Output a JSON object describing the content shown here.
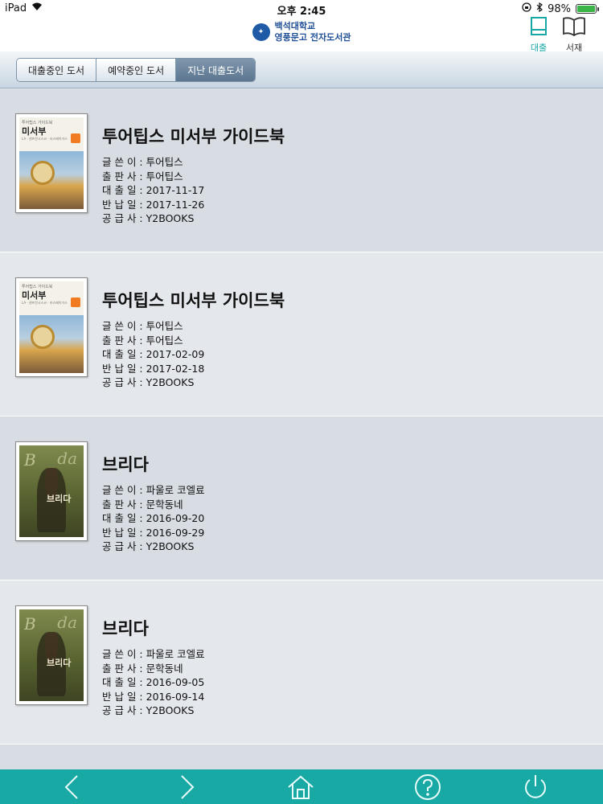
{
  "status_bar": {
    "device": "iPad",
    "time": "오후 2:45",
    "battery_text": "98%",
    "battery_level": 0.98
  },
  "header": {
    "logo_line1": "백석대학교",
    "logo_line2": "영풍문고 전자도서관",
    "loan_label": "대출",
    "shelf_label": "서재"
  },
  "tabs": [
    {
      "label": "대출중인 도서",
      "active": false
    },
    {
      "label": "예약중인 도서",
      "active": false
    },
    {
      "label": "지난 대출도서",
      "active": true
    }
  ],
  "field_labels": {
    "author": "글 쓴 이 :",
    "publisher": "출 판 사 :",
    "loan_date": "대 출 일 :",
    "return_date": "반 납 일 :",
    "supplier": "공 급 사 :"
  },
  "books": [
    {
      "title": "투어팁스 미서부 가이드북",
      "author": "투어팁스",
      "publisher": "투어팁스",
      "loan_date": "2017-11-17",
      "return_date": "2017-11-26",
      "supplier": "Y2BOOKS",
      "cover": {
        "style": "tour",
        "small_text": "투어팁스 가이드북",
        "big_text": "미서부",
        "sub_text": "LA · 샌프란시스코 · 라스베이거스"
      }
    },
    {
      "title": "투어팁스 미서부 가이드북",
      "author": "투어팁스",
      "publisher": "투어팁스",
      "loan_date": "2017-02-09",
      "return_date": "2017-02-18",
      "supplier": "Y2BOOKS",
      "cover": {
        "style": "tour",
        "small_text": "투어팁스 가이드북",
        "big_text": "미서부",
        "sub_text": "LA · 샌프란시스코 · 라스베이거스"
      }
    },
    {
      "title": "브리다",
      "author": "파울로 코엘료",
      "publisher": "문학동네",
      "loan_date": "2016-09-20",
      "return_date": "2016-09-29",
      "supplier": "Y2BOOKS",
      "cover": {
        "style": "brida",
        "big_text": "브리다",
        "deco_left": "B",
        "deco_right": "da"
      }
    },
    {
      "title": "브리다",
      "author": "파울로 코엘료",
      "publisher": "문학동네",
      "loan_date": "2016-09-05",
      "return_date": "2016-09-14",
      "supplier": "Y2BOOKS",
      "cover": {
        "style": "brida",
        "big_text": "브리다",
        "deco_left": "B",
        "deco_right": "da"
      }
    }
  ],
  "toolbar": [
    "back-icon",
    "forward-icon",
    "home-icon",
    "help-icon",
    "power-icon"
  ],
  "colors": {
    "accent": "#19a9a5",
    "brand": "#1f5aa6"
  }
}
